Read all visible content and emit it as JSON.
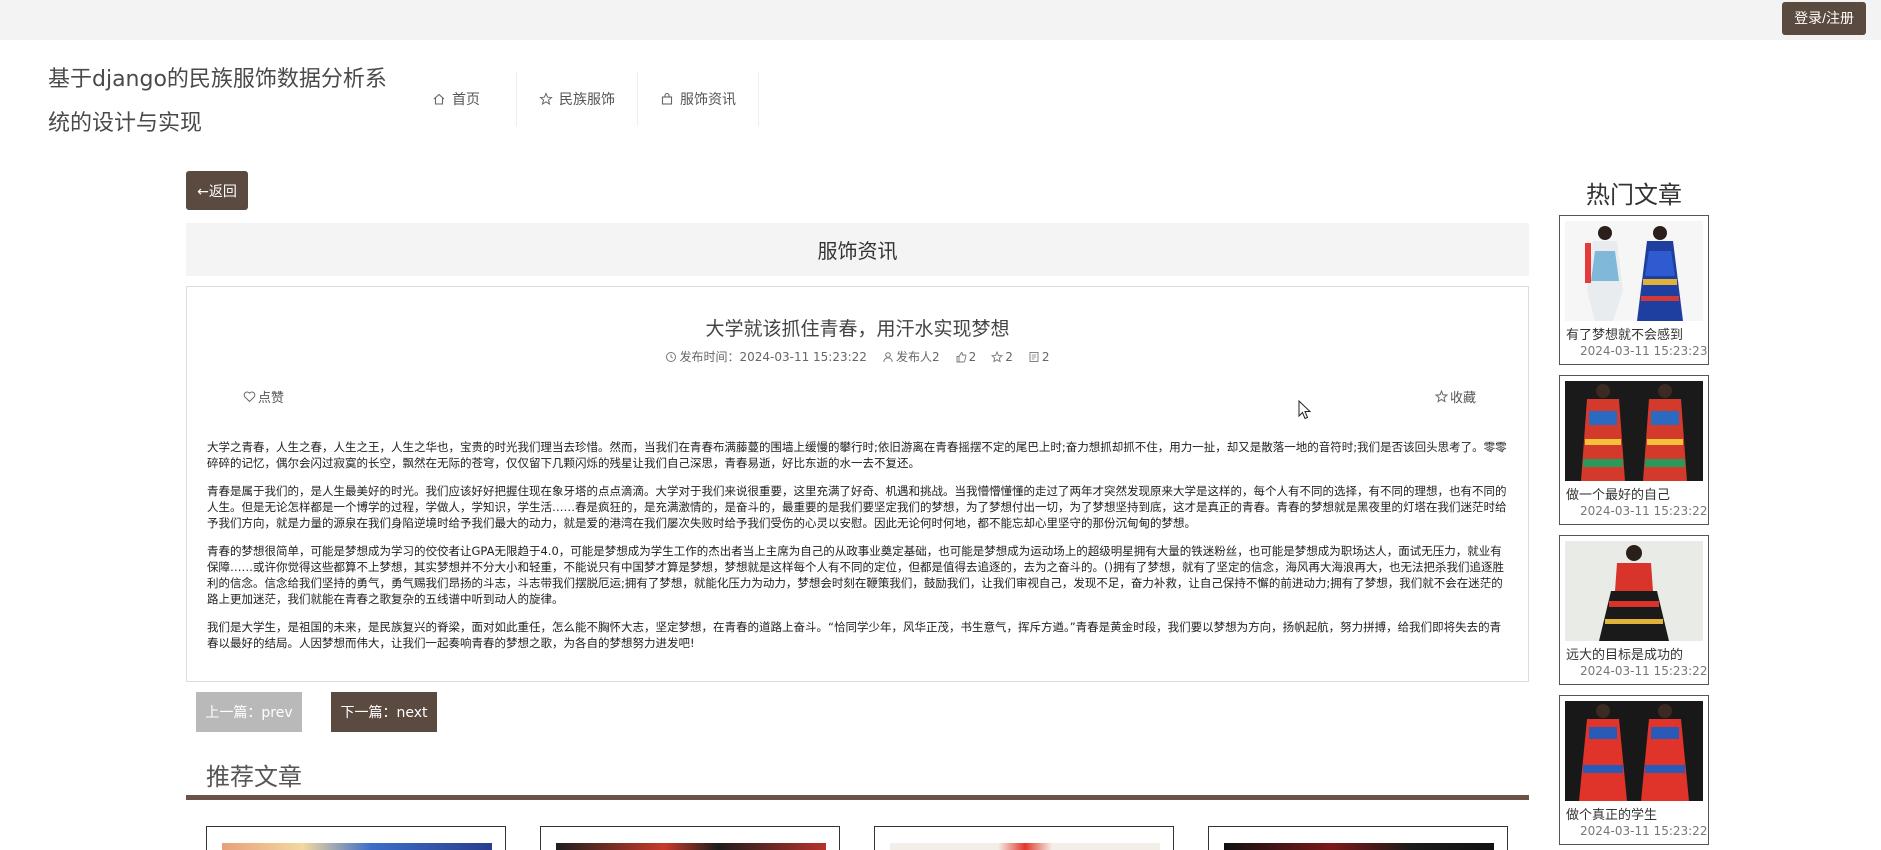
{
  "topbar": {
    "login_label": "登录/注册"
  },
  "brand": {
    "title": "基于django的民族服饰数据分析系统的设计与实现"
  },
  "nav": {
    "items": [
      {
        "label": "首页",
        "icon": "home-icon"
      },
      {
        "label": "民族服饰",
        "icon": "star-icon"
      },
      {
        "label": "服饰资讯",
        "icon": "bag-icon"
      }
    ]
  },
  "back": {
    "label": "←返回"
  },
  "section": {
    "title": "服饰资讯"
  },
  "article": {
    "title": "大学就该抓住青春，用汗水实现梦想",
    "publish_time": "发布时间：2024-03-11 15:23:22",
    "publisher": "发布人2",
    "likes": "2",
    "favorites": "2",
    "comments": "2",
    "like_label": "点赞",
    "fav_label": "收藏",
    "paragraphs": [
      "大学之青春，人生之春，人生之王，人生之华也，宝贵的时光我们理当去珍惜。然而，当我们在青春布满藤蔓的围墙上缓慢的攀行时;依旧游离在青春摇摆不定的尾巴上时;奋力想抓却抓不住，用力一扯，却又是散落一地的音符时;我们是否该回头思考了。零零碎碎的记忆，偶尔会闪过寂寞的长空，飘然在无际的苍穹，仅仅留下几颗闪烁的残星让我们自己深思，青春易逝，好比东逝的水一去不复还。",
      "青春是属于我们的，是人生最美好的时光。我们应该好好把握住现在象牙塔的点点滴滴。大学对于我们来说很重要，这里充满了好奇、机遇和挑战。当我懵懵懂懂的走过了两年才突然发现原来大学是这样的，每个人有不同的选择，有不同的理想，也有不同的人生。但是无论怎样都是一个博学的过程，学做人，学知识，学生活……春是疯狂的，是充满激情的，是奋斗的，最重要的是我们要坚定我们的梦想，为了梦想付出一切，为了梦想坚持到底，这才是真正的青春。青春的梦想就是黑夜里的灯塔在我们迷茫时给予我们方向，就是力量的源泉在我们身陷逆境时给予我们最大的动力，就是爱的港湾在我们屡次失败时给予我们受伤的心灵以安慰。因此无论何时何地，都不能忘却心里坚守的那份沉甸甸的梦想。",
      "青春的梦想很简单，可能是梦想成为学习的佼佼者让GPA无限趋于4.0，可能是梦想成为学生工作的杰出者当上主席为自己的从政事业奠定基础，也可能是梦想成为运动场上的超级明星拥有大量的铁迷粉丝，也可能是梦想成为职场达人，面试无压力，就业有保障……或许你觉得这些都算不上梦想，其实梦想并不分大小和轻重，不能说只有中国梦才算是梦想，梦想就是这样每个人有不同的定位，但都是值得去追逐的，去为之奋斗的。()拥有了梦想，就有了坚定的信念，海风再大海浪再大，也无法把杀我们追逐胜利的信念。信念给我们坚持的勇气，勇气赐我们昂扬的斗志，斗志带我们摆脱厄运;拥有了梦想，就能化压力为动力，梦想会时刻在鞭策我们，鼓励我们，让我们审视自己，发现不足，奋力补救，让自己保持不懈的前进动力;拥有了梦想，我们就不会在迷茫的路上更加迷茫，我们就能在青春之歌复杂的五线谱中听到动人的旋律。",
      "我们是大学生，是祖国的未来，是民族复兴的脊梁，面对如此重任，怎么能不胸怀大志，坚定梦想，在青春的道路上奋斗。“恰同学少年，风华正茂，书生意气，挥斥方遒。”青春是黄金时段，我们要以梦想为方向，扬帆起航，努力拼搏，给我们即将失去的青春以最好的结局。人因梦想而伟大，让我们一起奏响青春的梦想之歌，为各自的梦想努力进发吧!"
    ]
  },
  "pager": {
    "prev_label": "上一篇：prev",
    "next_label": "下一篇：next"
  },
  "recommend": {
    "title": "推荐文章"
  },
  "hot": {
    "title": "热门文章",
    "items": [
      {
        "title": "有了梦想就不会感到",
        "date": "2024-03-11 15:23:23"
      },
      {
        "title": "做一个最好的自己",
        "date": "2024-03-11 15:23:22"
      },
      {
        "title": "远大的目标是成功的",
        "date": "2024-03-11 15:23:22"
      },
      {
        "title": "做个真正的学生",
        "date": "2024-03-11 15:23:22"
      }
    ]
  },
  "colors": {
    "brand_brown": "#5b4a3f",
    "disabled_gray": "#b9b9b9",
    "accent_red": "#d9342b"
  }
}
